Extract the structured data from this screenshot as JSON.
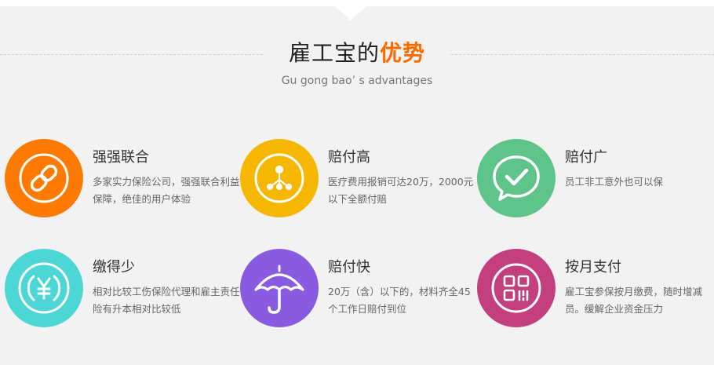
{
  "header": {
    "title_main": "雇工宝的",
    "title_accent": "优势",
    "subtitle": "Gu gong bao’ s advantages"
  },
  "colors": {
    "accent": "#ff6a00",
    "orange": "#ff7a00",
    "yellow": "#f5b700",
    "green": "#5ec48a",
    "cyan": "#4cd6d6",
    "purple": "#8a5be0",
    "magenta": "#c43f7e"
  },
  "features": [
    {
      "icon": "link-icon",
      "title": "强强联合",
      "desc": "多家实力保险公司，强强联合利益保障，绝佳的用户体验"
    },
    {
      "icon": "network-icon",
      "title": "赔付高",
      "desc": "医疗费用报销可达20万，2000元以下全额付赔"
    },
    {
      "icon": "chat-check-icon",
      "title": "赔付广",
      "desc": "员工非工意外也可以保"
    },
    {
      "icon": "yen-icon",
      "title": "缴得少",
      "desc": "相对比较工伤保险代理和雇主责任 险有升本相对比较低"
    },
    {
      "icon": "umbrella-icon",
      "title": "赔付快",
      "desc": "20万（含）以下的，材料齐全45个工作日赔付到位"
    },
    {
      "icon": "qr-grid-icon",
      "title": "按月支付",
      "desc": "雇工宝参保按月缴费，随时增减员。缓解企业资金压力"
    }
  ]
}
